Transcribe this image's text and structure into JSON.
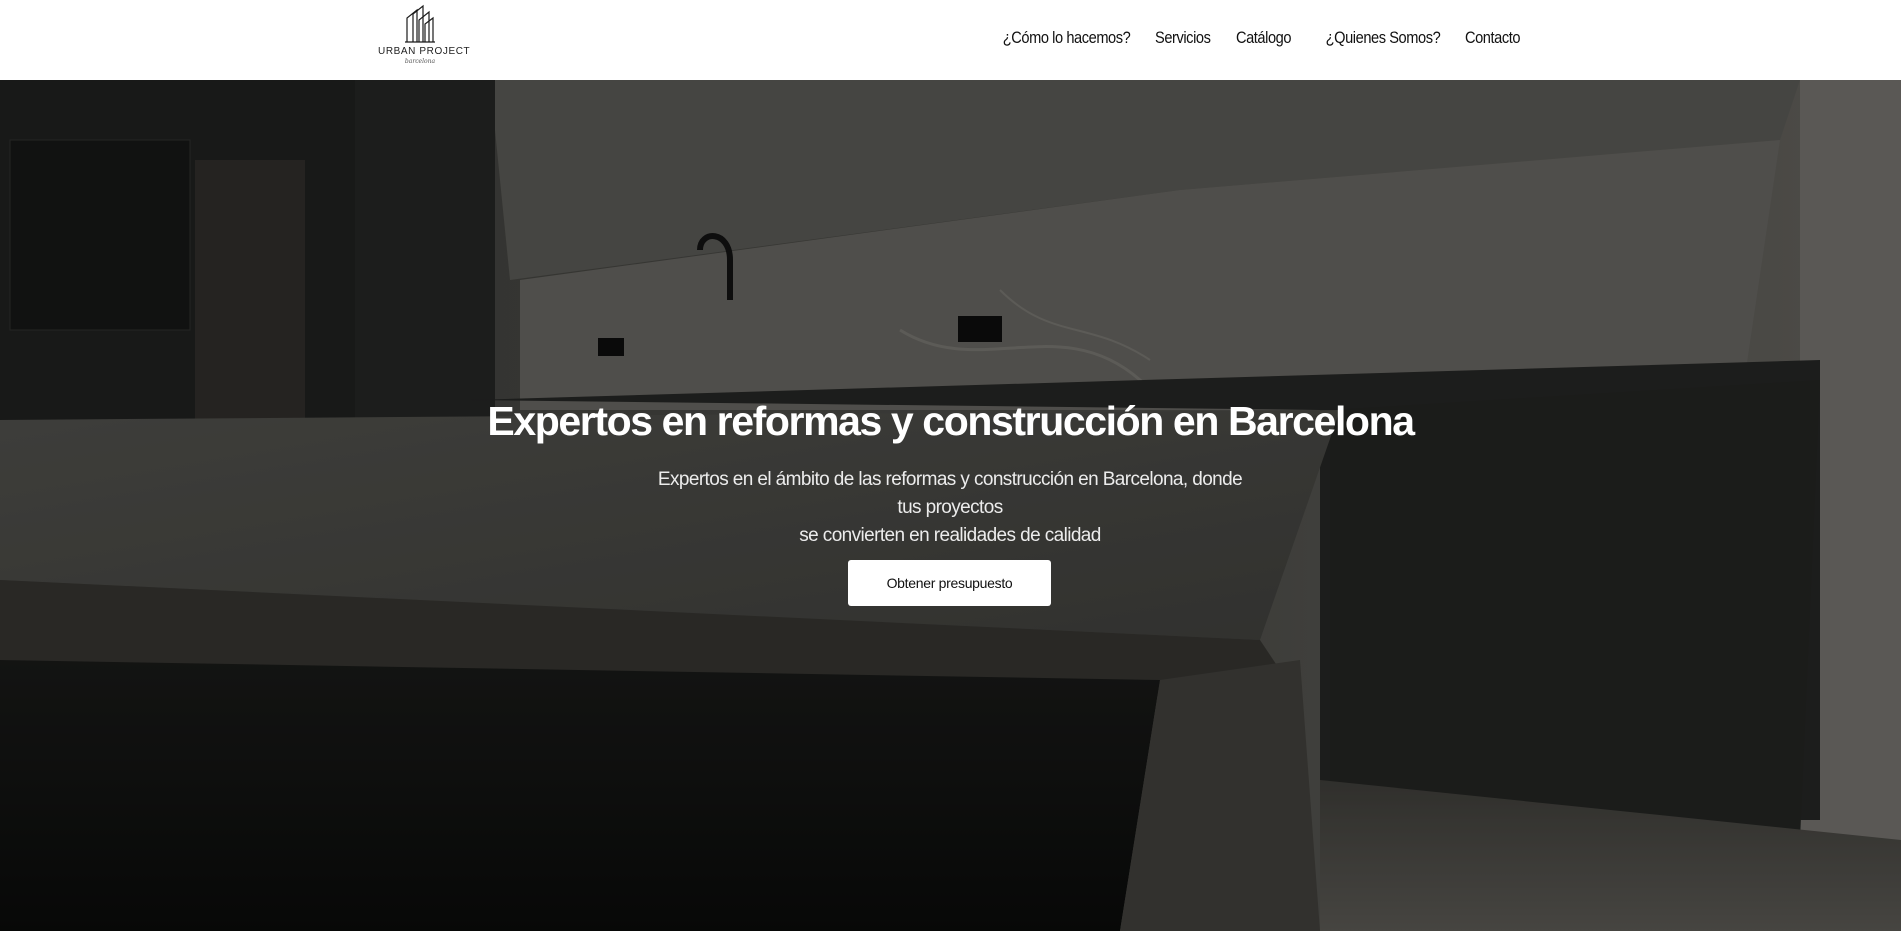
{
  "header": {
    "logo": {
      "name": "URBAN PROJECT",
      "sub": "barcelona"
    },
    "nav": [
      {
        "label": "¿Cómo lo hacemos?"
      },
      {
        "label": "Servicios"
      },
      {
        "label": "Catálogo"
      },
      {
        "label": "¿Quienes Somos?"
      },
      {
        "label": "Contacto"
      }
    ]
  },
  "hero": {
    "title": "Expertos en reformas y construcción en Barcelona",
    "subtitle_line1": "Expertos en el ámbito de las reformas y construcción en Barcelona, donde tus proyectos",
    "subtitle_line2": "se convierten en realidades de calidad",
    "cta_label": "Obtener presupuesto",
    "background": "kitchen-photo"
  },
  "colors": {
    "header_bg": "#ffffff",
    "nav_text": "#111111",
    "hero_text": "#ffffff",
    "cta_bg": "#ffffff",
    "cta_text": "#111111"
  }
}
